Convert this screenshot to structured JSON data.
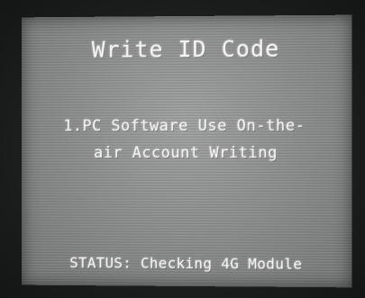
{
  "screen": {
    "title": "Write ID Code",
    "message_line1": "1.PC Software Use On-the-",
    "message_line2": "air Account Writing",
    "status": "STATUS: Checking 4G Module"
  }
}
